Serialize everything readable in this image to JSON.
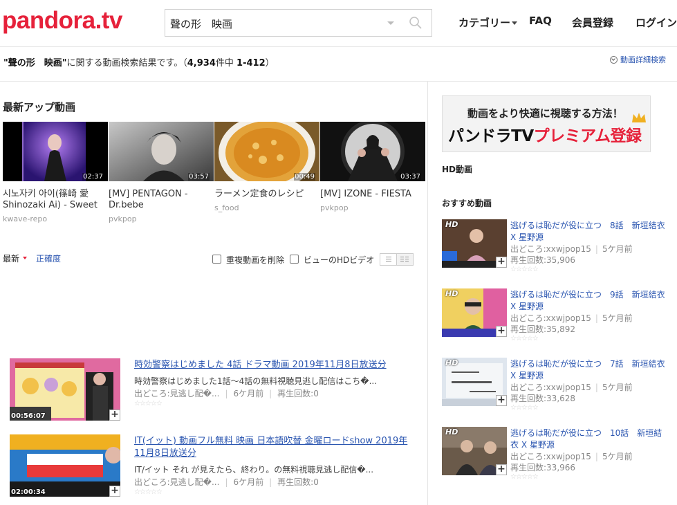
{
  "header": {
    "logo_main": "pandora",
    "logo_tv": ".tv",
    "search_value": "聲の形　映画",
    "nav": {
      "category": "カテゴリー",
      "faq": "FAQ",
      "register": "会員登録",
      "login": "ログイン"
    }
  },
  "results": {
    "query": "\"聲の形　映画\"",
    "suffix": "に関する動画検索結果です。（",
    "total": "4,934",
    "of": "件中",
    "range": "1-412",
    "close": "）",
    "advanced_search": "動画詳細検索"
  },
  "latest": {
    "title": "最新アップ動画",
    "videos": [
      {
        "title": "시노자키 아이(篠崎 愛 Shinozaki Ai) - Sweet",
        "source": "kwave-repo",
        "duration": "02:37"
      },
      {
        "title": "[MV] PENTAGON - Dr.bebe",
        "source": "pvkpop",
        "duration": "03:57"
      },
      {
        "title": "ラーメン定食のレシピ",
        "source": "s_food",
        "duration": "00:49"
      },
      {
        "title": "[MV] IZONE - FIESTA",
        "source": "pvkpop",
        "duration": "03:37"
      }
    ]
  },
  "sort": {
    "newest": "最新",
    "accuracy": "正確度",
    "remove_duplicates": "重複動画を削除",
    "hd_view": "ビューのHDビデオ"
  },
  "list": [
    {
      "title": "時効警察はじめました 4話 ドラマ動画 2019年11月8日放送分",
      "desc": "時効警察はじめました1話～4話の無料視聴見逃し配信はこち�...",
      "source": "出どころ:見逃し配�...",
      "age": "6ケ月前",
      "views": "再生回数:0",
      "duration": "00:56:07"
    },
    {
      "title": "IT(イット) 動画フル無料 映画 日本語吹替 金曜ロードshow 2019年11月8日放送分",
      "desc": "IT/イット それ が見えたら、終わり。の無料視聴見逃し配信�...",
      "source": "出どころ:見逃し配�...",
      "age": "6ケ月前",
      "views": "再生回数:0",
      "duration": "02:00:34"
    }
  ],
  "sidebar": {
    "banner_line1": "動画をより快適に視聴する方法！",
    "banner_line2a": "パンドラTV",
    "banner_line2b": "プレミアム登録",
    "hd_title": "HD動画",
    "rec_title": "おすすめ動画",
    "hd_badge": "HD",
    "items": [
      {
        "title": "逃げるは恥だが役に立つ　8話　新垣結衣 X 星野源",
        "source": "出どころ:xxwjpop15",
        "age": "5ケ月前",
        "views": "再生回数:35,906"
      },
      {
        "title": "逃げるは恥だが役に立つ　9話　新垣結衣 X 星野源",
        "source": "出どころ:xxwjpop15",
        "age": "5ケ月前",
        "views": "再生回数:35,892"
      },
      {
        "title": "逃げるは恥だが役に立つ　7話　新垣結衣 X 星野源",
        "source": "出どころ:xxwjpop15",
        "age": "5ケ月前",
        "views": "再生回数:33,628"
      },
      {
        "title": "逃げるは恥だが役に立つ　10話　新垣結衣 X 星野源",
        "source": "出どころ:xxwjpop15",
        "age": "5ケ月前",
        "views": "再生回数:33,966"
      }
    ]
  },
  "stars": "☆☆☆☆☆",
  "colors": {
    "brand_red": "#e6213a",
    "link_blue": "#2a55b0"
  }
}
